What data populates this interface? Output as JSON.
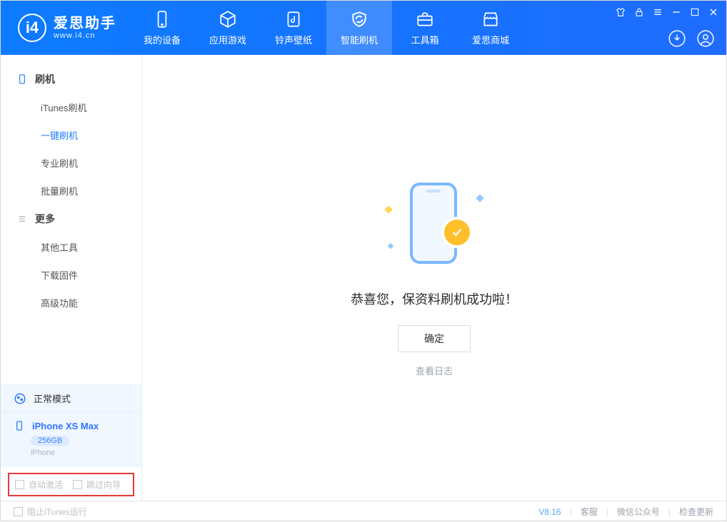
{
  "app": {
    "name": "爱思助手",
    "url": "www.i4.cn"
  },
  "tabs": {
    "device": "我的设备",
    "apps": "应用游戏",
    "ring": "铃声壁纸",
    "flash": "智能刷机",
    "tools": "工具箱",
    "store": "爱思商城"
  },
  "sidebar": {
    "group1": {
      "title": "刷机",
      "items": [
        "iTunes刷机",
        "一键刷机",
        "专业刷机",
        "批量刷机"
      ],
      "active_index": 1
    },
    "group2": {
      "title": "更多",
      "items": [
        "其他工具",
        "下载固件",
        "高级功能"
      ]
    }
  },
  "mode": {
    "label": "正常模式"
  },
  "device": {
    "name": "iPhone XS Max",
    "storage": "256GB",
    "type": "iPhone"
  },
  "checks": {
    "auto_activate": "自动激活",
    "skip_guide": "跳过向导"
  },
  "main": {
    "success_msg": "恭喜您，保资料刷机成功啦！",
    "ok": "确定",
    "log": "查看日志"
  },
  "footer": {
    "block_itunes": "阻止iTunes运行",
    "version": "V8.16",
    "cs": "客服",
    "wechat": "微信公众号",
    "update": "检查更新"
  }
}
